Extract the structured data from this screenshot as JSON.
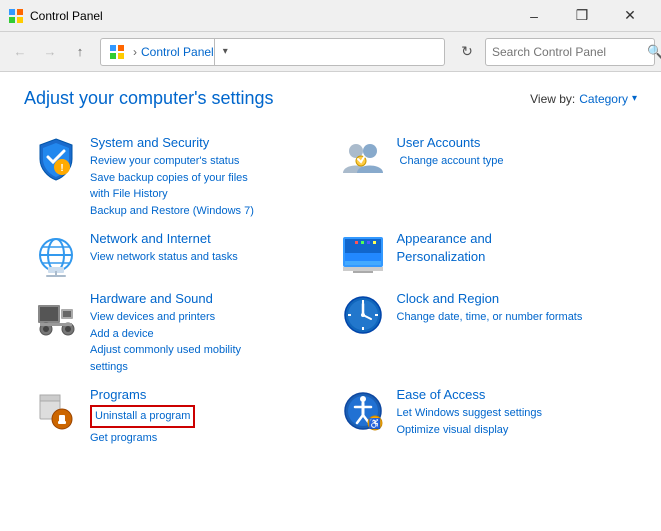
{
  "titleBar": {
    "icon": "control-panel",
    "title": "Control Panel",
    "minimizeLabel": "–",
    "restoreLabel": "❒",
    "closeLabel": "✕"
  },
  "navBar": {
    "backDisabled": true,
    "forwardDisabled": true,
    "upLabel": "↑",
    "breadcrumb": {
      "icon": "control-panel-icon",
      "separator": "›",
      "current": "Control Panel"
    },
    "dropdownArrow": "▾",
    "refreshLabel": "↻",
    "searchPlaceholder": "Search Control Panel",
    "searchIconLabel": "🔍"
  },
  "main": {
    "title": "Adjust your computer's settings",
    "viewBy": {
      "label": "View by: ",
      "value": "Category",
      "arrow": "▾"
    },
    "categories": [
      {
        "id": "system-security",
        "title": "System and Security",
        "links": [
          "Review your computer's status",
          "Save backup copies of your files with File History",
          "Backup and Restore (Windows 7)"
        ]
      },
      {
        "id": "user-accounts",
        "title": "User Accounts",
        "links": [
          "Change account type"
        ]
      },
      {
        "id": "network-internet",
        "title": "Network and Internet",
        "links": [
          "View network status and tasks"
        ]
      },
      {
        "id": "appearance",
        "title": "Appearance and Personalization",
        "links": []
      },
      {
        "id": "hardware-sound",
        "title": "Hardware and Sound",
        "links": [
          "View devices and printers",
          "Add a device",
          "Adjust commonly used mobility settings"
        ]
      },
      {
        "id": "clock-region",
        "title": "Clock and Region",
        "links": [
          "Change date, time, or number formats"
        ]
      },
      {
        "id": "programs",
        "title": "Programs",
        "links": [
          "Uninstall a program",
          "Get programs"
        ]
      },
      {
        "id": "ease-access",
        "title": "Ease of Access",
        "links": [
          "Let Windows suggest settings",
          "Optimize visual display"
        ]
      }
    ]
  }
}
